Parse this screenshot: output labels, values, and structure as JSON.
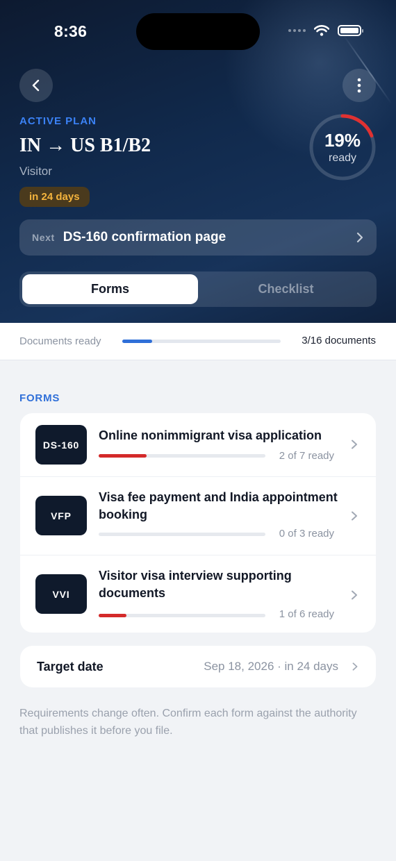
{
  "status_bar": {
    "time": "8:36"
  },
  "header": {
    "back_icon": "chevron-left-icon",
    "more_icon": "vertical-dots-icon",
    "label": "ACTIVE PLAN",
    "title": "IN → US B1/B2",
    "subtitle": "Visitor",
    "badge": "in 24 days",
    "badge_color": "#f3b33d"
  },
  "readiness": {
    "percent_text": "19%",
    "caption": "ready",
    "value": 0.19,
    "color": "#e03131"
  },
  "next_step": {
    "label": "Next",
    "text": "DS-160 confirmation page"
  },
  "tabs": [
    {
      "label": "Forms",
      "active": true
    },
    {
      "label": "Checklist",
      "active": false
    }
  ],
  "documents": {
    "label": "Documents ready",
    "count": "3/16 documents",
    "progress": 0.1875,
    "color": "#2f6fd8"
  },
  "forms_section": {
    "label": "FORMS",
    "items": [
      {
        "code": "DS-160",
        "title": "Online nonimmigrant visa application",
        "status": "2 of 7 ready",
        "progress": 0.2857
      },
      {
        "code": "VFP",
        "title": "Visa fee payment and India appointment booking",
        "status": "0 of 3 ready",
        "progress": 0
      },
      {
        "code": "VVI",
        "title": "Visitor visa interview supporting documents",
        "status": "1 of 6 ready",
        "progress": 0.1667
      }
    ]
  },
  "target_date": {
    "label": "Target date",
    "value": "Sep 18, 2026 · in 24 days"
  },
  "footnote": "Requirements change often. Confirm each form against the authority that publishes it before you file."
}
